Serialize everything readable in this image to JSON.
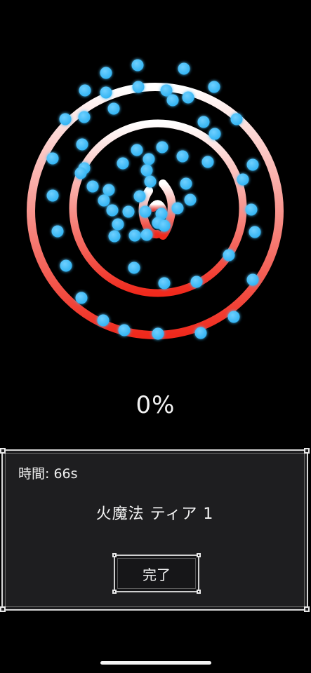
{
  "game": {
    "progress_text": "0%",
    "ring_color_top": "#ffffff",
    "ring_color_bottom": "#f0291c",
    "orb_color": "#2fb2f2"
  },
  "panel": {
    "timer_text": "時間: 66s",
    "spell_name": "火魔法 ティア 1",
    "done_label": "完了"
  }
}
